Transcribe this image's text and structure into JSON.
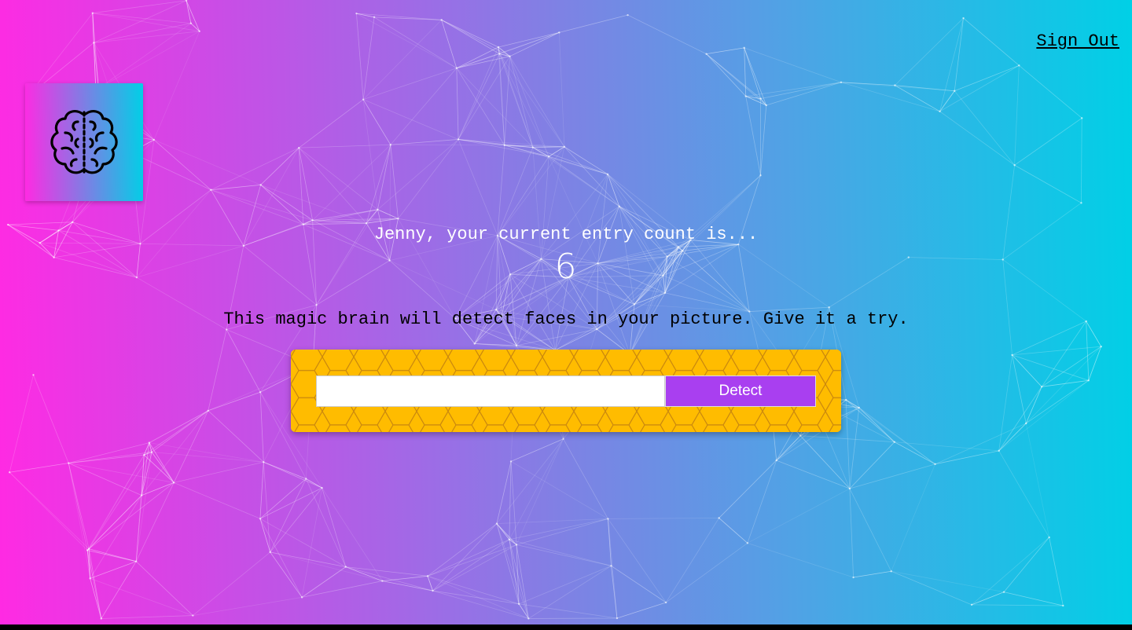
{
  "nav": {
    "signout_label": "Sign Out"
  },
  "logo": {
    "icon": "brain-icon"
  },
  "rank": {
    "greeting": "Jenny, your current entry count is...",
    "count": "6"
  },
  "form": {
    "subtitle": "This magic brain will detect faces in your picture. Give it a try.",
    "input_value": "",
    "button_label": "Detect"
  },
  "colors": {
    "gradient_left": "#ff2ae3",
    "gradient_right": "#00d0e6",
    "form_background": "#ffbc00",
    "button": "#a93ff0",
    "particle_lines": "#ffffff"
  }
}
